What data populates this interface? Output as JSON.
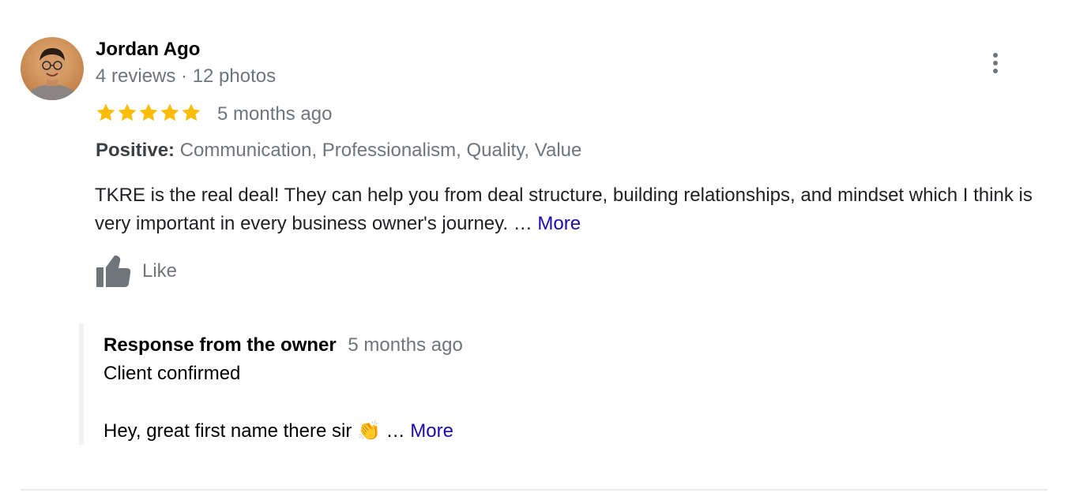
{
  "reviewer": {
    "name": "Jordan Ago",
    "meta": "4 reviews · 12 photos"
  },
  "review": {
    "rating": 5,
    "rating_max": 5,
    "time": "5 months ago",
    "positive_label": "Positive:",
    "positive_values": "Communication, Professionalism, Quality, Value",
    "text": "TKRE is the real deal! They can help you from deal structure, building relationships, and mindset which I think is very important in every business owner's journey.",
    "ellipsis": "…",
    "more_label": "More",
    "like_label": "Like",
    "star_color": "#fbbc04"
  },
  "owner_response": {
    "title": "Response from the owner",
    "time": "5 months ago",
    "line1": "Client confirmed",
    "line2": "Hey, great first name there sir",
    "emoji": "👏",
    "ellipsis": "…",
    "more_label": "More"
  }
}
